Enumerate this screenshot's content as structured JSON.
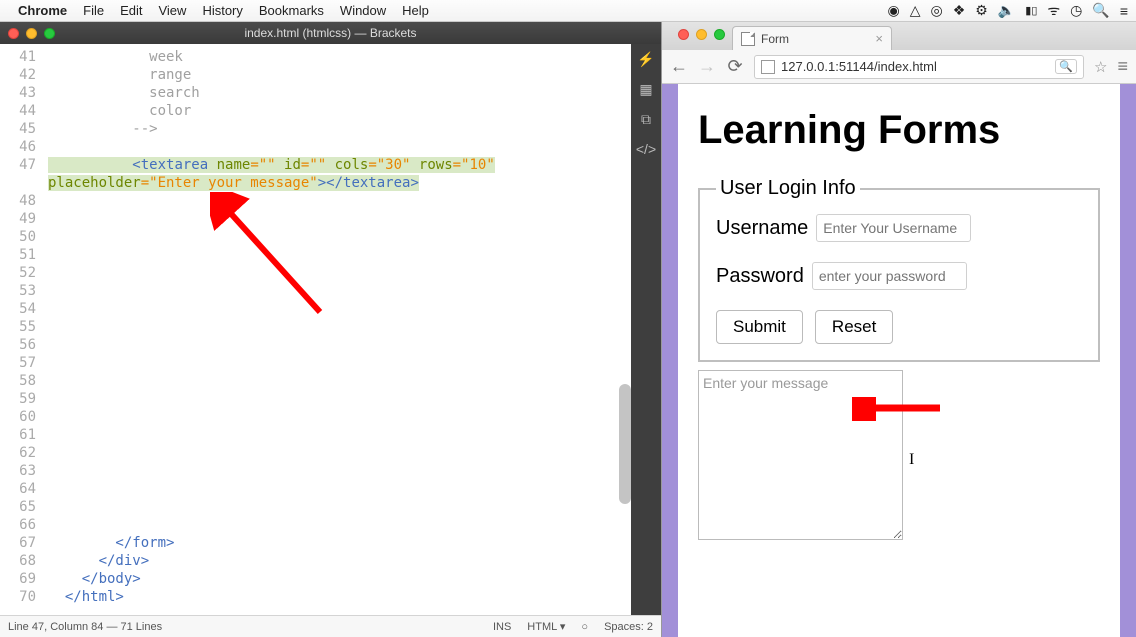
{
  "menubar": {
    "app": "Chrome",
    "items": [
      "File",
      "Edit",
      "View",
      "History",
      "Bookmarks",
      "Window",
      "Help"
    ]
  },
  "brackets": {
    "title": "index.html (htmlcss) — Brackets",
    "lines": [
      {
        "n": "41",
        "frags": [
          {
            "t": "            week",
            "cls": "c-gray"
          }
        ]
      },
      {
        "n": "42",
        "frags": [
          {
            "t": "            range",
            "cls": "c-gray"
          }
        ]
      },
      {
        "n": "43",
        "frags": [
          {
            "t": "            search",
            "cls": "c-gray"
          }
        ]
      },
      {
        "n": "44",
        "frags": [
          {
            "t": "            color",
            "cls": "c-gray"
          }
        ]
      },
      {
        "n": "45",
        "frags": [
          {
            "t": "          -->",
            "cls": "c-gray"
          }
        ]
      },
      {
        "n": "46",
        "frags": []
      },
      {
        "n": "47",
        "hl": true,
        "frags": [
          {
            "t": "          "
          },
          {
            "t": "<textarea ",
            "cls": "c-blue"
          },
          {
            "t": "name",
            "cls": "c-green"
          },
          {
            "t": "=\"\" ",
            "cls": "c-orange"
          },
          {
            "t": "id",
            "cls": "c-green"
          },
          {
            "t": "=\"\" ",
            "cls": "c-orange"
          },
          {
            "t": "cols",
            "cls": "c-green"
          },
          {
            "t": "=\"30\" ",
            "cls": "c-orange"
          },
          {
            "t": "rows",
            "cls": "c-green"
          },
          {
            "t": "=\"10\"",
            "cls": "c-orange"
          }
        ]
      },
      {
        "n": "",
        "hl": true,
        "frags": [
          {
            "t": "placeholder",
            "cls": "c-green"
          },
          {
            "t": "=\"Enter your message\"",
            "cls": "c-orange"
          },
          {
            "t": "></textarea>",
            "cls": "c-blue"
          }
        ]
      },
      {
        "n": "48",
        "frags": []
      },
      {
        "n": "49",
        "frags": []
      },
      {
        "n": "50",
        "frags": []
      },
      {
        "n": "51",
        "frags": []
      },
      {
        "n": "52",
        "frags": []
      },
      {
        "n": "53",
        "frags": []
      },
      {
        "n": "54",
        "frags": []
      },
      {
        "n": "55",
        "frags": []
      },
      {
        "n": "56",
        "frags": []
      },
      {
        "n": "57",
        "frags": []
      },
      {
        "n": "58",
        "frags": []
      },
      {
        "n": "59",
        "frags": []
      },
      {
        "n": "60",
        "frags": []
      },
      {
        "n": "61",
        "frags": []
      },
      {
        "n": "62",
        "frags": []
      },
      {
        "n": "63",
        "frags": []
      },
      {
        "n": "64",
        "frags": []
      },
      {
        "n": "65",
        "frags": []
      },
      {
        "n": "66",
        "frags": []
      },
      {
        "n": "67",
        "frags": [
          {
            "t": "        </form>",
            "cls": "c-blue"
          }
        ]
      },
      {
        "n": "68",
        "frags": [
          {
            "t": "      </div>",
            "cls": "c-blue"
          }
        ]
      },
      {
        "n": "69",
        "frags": [
          {
            "t": "    </body>",
            "cls": "c-blue"
          }
        ]
      },
      {
        "n": "70",
        "frags": [
          {
            "t": "  </html>",
            "cls": "c-blue"
          }
        ]
      }
    ],
    "status_left": "Line 47, Column 84 — 71 Lines",
    "status_ins": "INS",
    "status_lang": "HTML ▾",
    "status_spaces": "Spaces: 2"
  },
  "chrome": {
    "tab_title": "Form",
    "url": "127.0.0.1:51144/index.html"
  },
  "page": {
    "h1": "Learning Forms",
    "legend": "User Login Info",
    "username_label": "Username",
    "username_ph": "Enter Your Username",
    "password_label": "Password",
    "password_ph": "enter your password",
    "submit": "Submit",
    "reset": "Reset",
    "textarea_ph": "Enter your message"
  }
}
